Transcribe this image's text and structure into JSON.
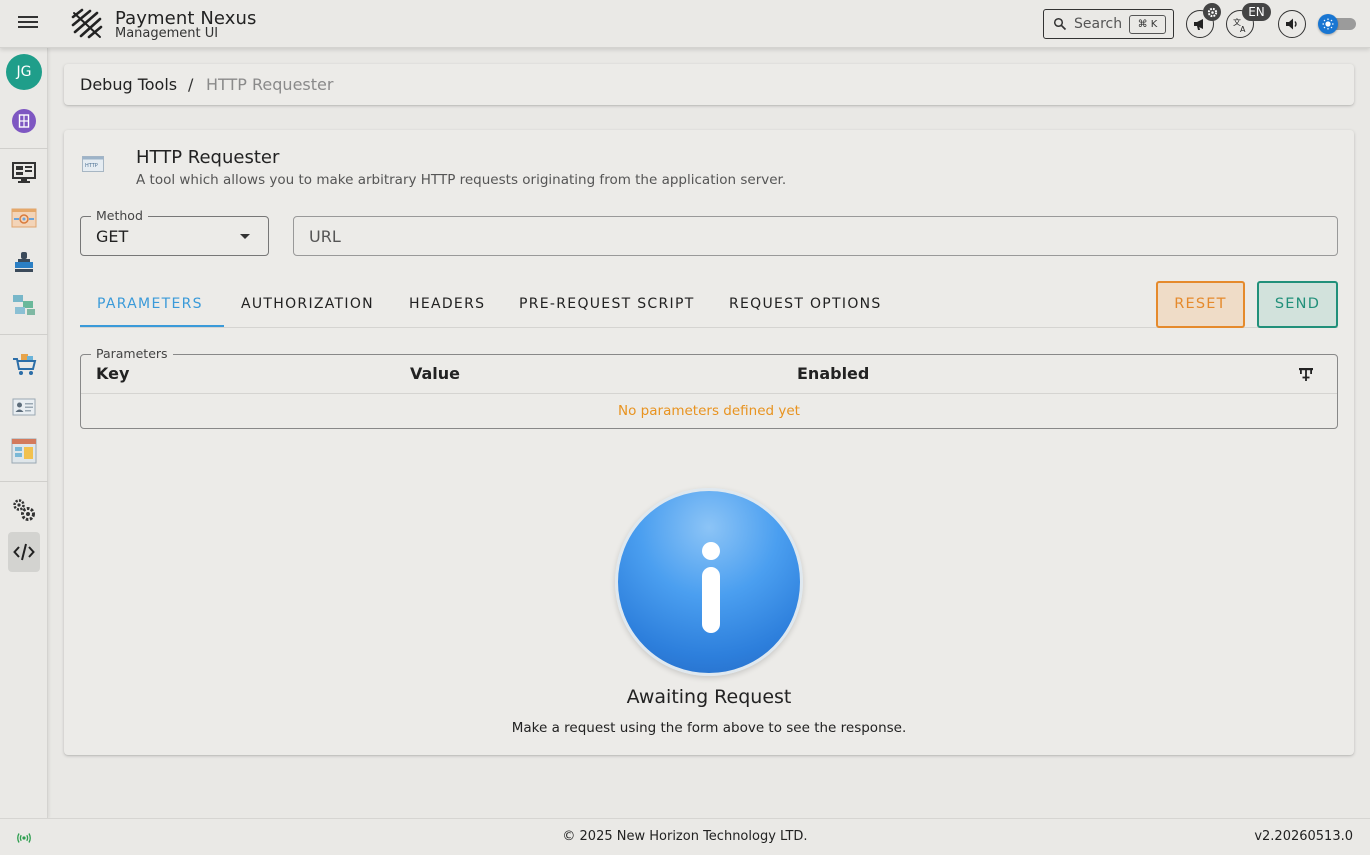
{
  "app": {
    "title": "Payment Nexus",
    "subtitle": "Management UI"
  },
  "topbar": {
    "search_label": "Search",
    "search_shortcut": "⌘ K",
    "language": "EN",
    "icons": [
      "menu-icon",
      "announcement-icon",
      "settings-badge-icon",
      "translate-icon",
      "volume-icon",
      "brightness-icon"
    ]
  },
  "sidebar": {
    "avatar_initials": "JG",
    "items": [
      {
        "name": "organization-icon"
      },
      {
        "name": "monitor-dashboard-icon"
      },
      {
        "name": "payment-gateway-icon"
      },
      {
        "name": "terminal-stamp-icon"
      },
      {
        "name": "network-routing-icon"
      },
      {
        "name": "merchant-cart-icon"
      },
      {
        "name": "customer-id-card-icon"
      },
      {
        "name": "reports-icon"
      },
      {
        "name": "system-settings-icon"
      },
      {
        "name": "debug-code-icon",
        "active": true
      }
    ]
  },
  "breadcrumb": {
    "parent": "Debug Tools",
    "separator": "/",
    "current": "HTTP Requester"
  },
  "tool": {
    "icon": "http-icon",
    "title": "HTTP Requester",
    "description": "A tool which allows you to make arbitrary HTTP requests originating from the application server."
  },
  "form": {
    "method_label": "Method",
    "method_value": "GET",
    "url_placeholder": "URL"
  },
  "tabs": [
    {
      "label": "PARAMETERS",
      "active": true
    },
    {
      "label": "AUTHORIZATION"
    },
    {
      "label": "HEADERS"
    },
    {
      "label": "PRE-REQUEST SCRIPT"
    },
    {
      "label": "REQUEST OPTIONS"
    }
  ],
  "actions": {
    "reset_label": "RESET",
    "send_label": "SEND"
  },
  "parameters": {
    "legend": "Parameters",
    "columns": [
      "Key",
      "Value",
      "Enabled"
    ],
    "empty_message": "No parameters defined yet"
  },
  "response": {
    "title": "Awaiting Request",
    "message": "Make a request using the form above to see the response."
  },
  "footer": {
    "copyright": "© 2025 New Horizon Technology LTD.",
    "version": "v2.20260513.0"
  },
  "colors": {
    "accent_blue": "#3a9ad9",
    "reset_orange": "#e58a2c",
    "send_teal": "#21907a",
    "empty_text": "#e89320",
    "avatar": "#1f9e8a"
  }
}
